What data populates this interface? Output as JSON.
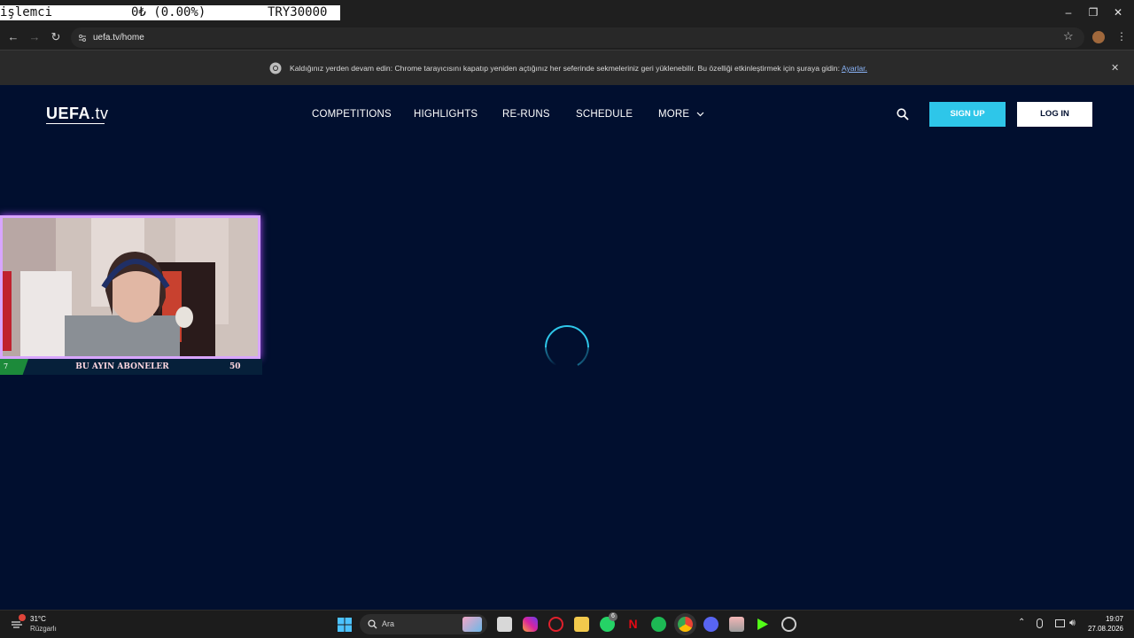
{
  "ticker": {
    "label": "işlemci",
    "value": "0₺ (0.00%)",
    "goal": "TRY30000"
  },
  "browser": {
    "url": "uefa.tv/home",
    "infobar_text": "Kaldığınız yerden devam edin: Chrome tarayıcısını kapatıp yeniden açtığınız her seferinde sekmeleriniz geri yüklenebilir. Bu özelliği etkinleştirmek için şuraya gidin: ",
    "infobar_link": "Ayarlar."
  },
  "site": {
    "logo_main": "UEFA",
    "logo_suffix": ".tv",
    "nav": {
      "competitions": "COMPETITIONS",
      "highlights": "HIGHLIGHTS",
      "reruns": "RE-RUNS",
      "schedule": "SCHEDULE",
      "more": "MORE"
    },
    "signup": "SIGN UP",
    "login": "LOG IN"
  },
  "webcam": {
    "label": "BU AYIN ABONELER",
    "left_count": "7",
    "right_count": "50"
  },
  "taskbar": {
    "weather_temp": "31°C",
    "weather_desc": "Rüzgarlı",
    "search_placeholder": "Ara",
    "time": "19:07",
    "date": "27.08.2026",
    "whatsapp_badge": "6"
  },
  "colors": {
    "site_bg": "#010f2f",
    "signup_bg": "#2ec6e9",
    "webcam_glow": "#b24dff"
  }
}
